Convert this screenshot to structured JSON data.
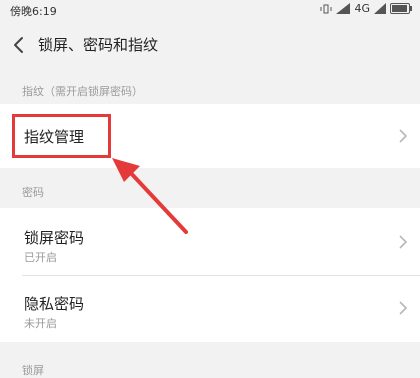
{
  "status_bar": {
    "time": "傍晚6:19",
    "network": "4G"
  },
  "header": {
    "title": "锁屏、密码和指纹"
  },
  "sections": {
    "fingerprint": {
      "header": "指纹（需开启锁屏密码）",
      "items": [
        {
          "label": "指纹管理"
        }
      ]
    },
    "password": {
      "header": "密码",
      "items": [
        {
          "label": "锁屏密码",
          "status": "已开启"
        },
        {
          "label": "隐私密码",
          "status": "未开启"
        }
      ]
    },
    "lockscreen": {
      "header": "锁屏"
    }
  },
  "annotation": {
    "color": "#e53a3a"
  },
  "icons": [
    "back-arrow-icon",
    "chevron-right-icon",
    "signal-icon",
    "battery-icon"
  ]
}
